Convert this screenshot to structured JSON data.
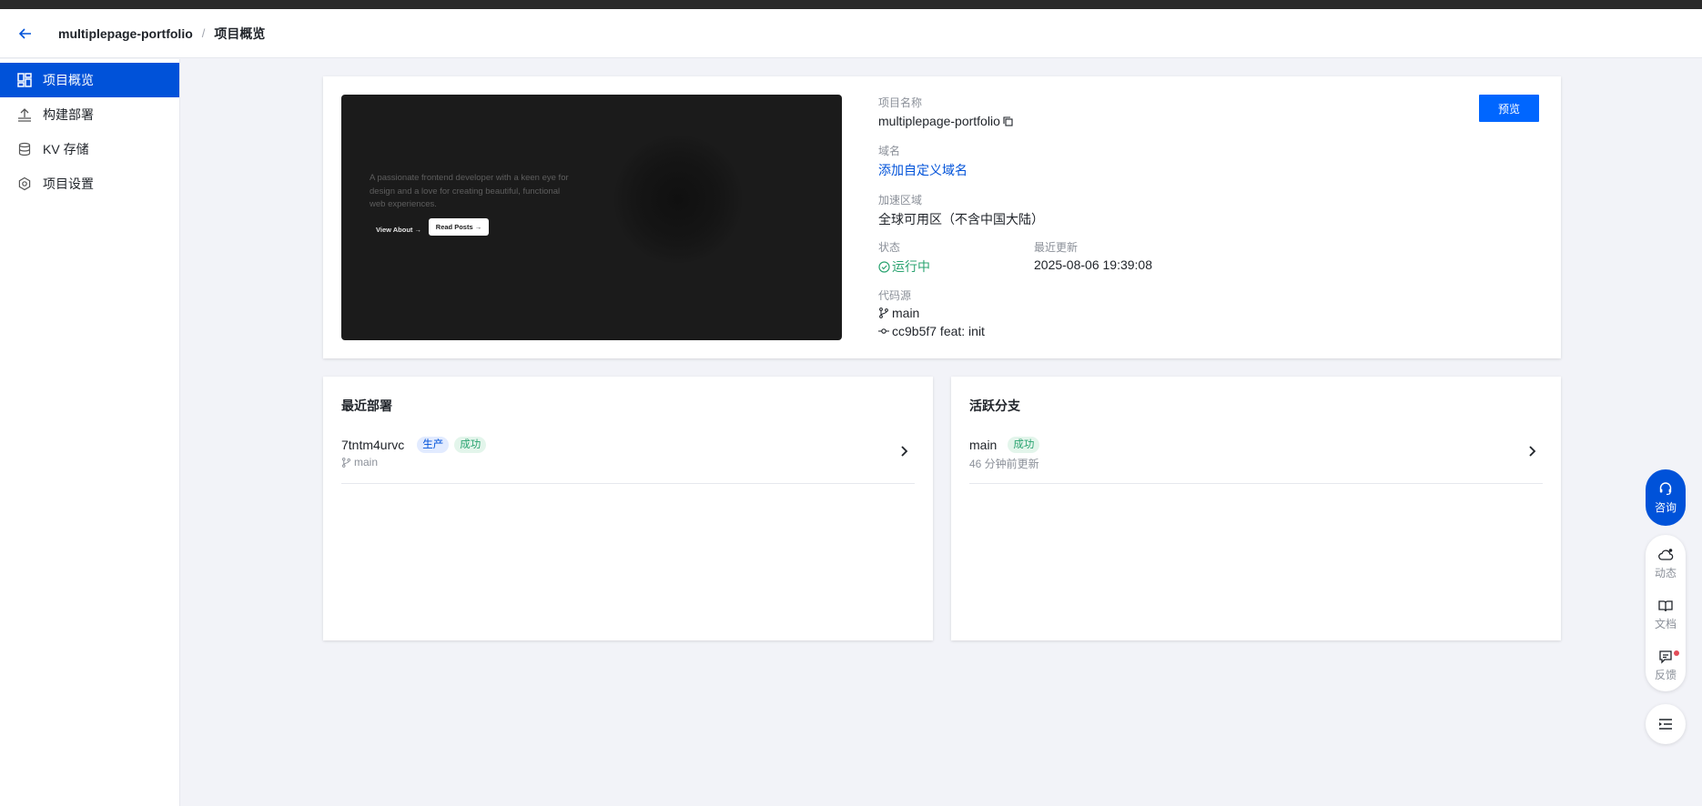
{
  "header": {
    "project": "multiplepage-portfolio",
    "separator": "/",
    "page": "项目概览"
  },
  "sidebar": {
    "items": [
      {
        "label": "项目概览",
        "icon": "dashboard-icon",
        "active": true
      },
      {
        "label": "构建部署",
        "icon": "upload-icon",
        "active": false
      },
      {
        "label": "KV 存储",
        "icon": "database-icon",
        "active": false
      },
      {
        "label": "项目设置",
        "icon": "settings-icon",
        "active": false
      }
    ]
  },
  "overview": {
    "preview_image": {
      "text": "A passionate frontend developer with a keen eye for design and a love for creating beautiful, functional web experiences.",
      "button1": "View About →",
      "button2": "Read Posts →"
    },
    "name_label": "项目名称",
    "name_value": "multiplepage-portfolio",
    "domain_label": "域名",
    "domain_value": "添加自定义域名",
    "region_label": "加速区域",
    "region_value": "全球可用区（不含中国大陆）",
    "status_label": "状态",
    "status_value": "运行中",
    "updated_label": "最近更新",
    "updated_value": "2025-08-06 19:39:08",
    "source_label": "代码源",
    "branch": "main",
    "commit": "cc9b5f7 feat: init",
    "preview_button": "预览"
  },
  "recent_deploys": {
    "title": "最近部署",
    "items": [
      {
        "id": "7tntm4urvc",
        "env_tag": "生产",
        "status_tag": "成功",
        "branch": "main"
      }
    ]
  },
  "active_branches": {
    "title": "活跃分支",
    "items": [
      {
        "name": "main",
        "status_tag": "成功",
        "updated": "46 分钟前更新"
      }
    ]
  },
  "floating": {
    "consult": "咨询",
    "news": "动态",
    "docs": "文档",
    "feedback": "反馈"
  },
  "colors": {
    "primary": "#0052d9",
    "preview_button": "#0066ff",
    "success": "#2ba471",
    "background": "#f2f3f8"
  }
}
